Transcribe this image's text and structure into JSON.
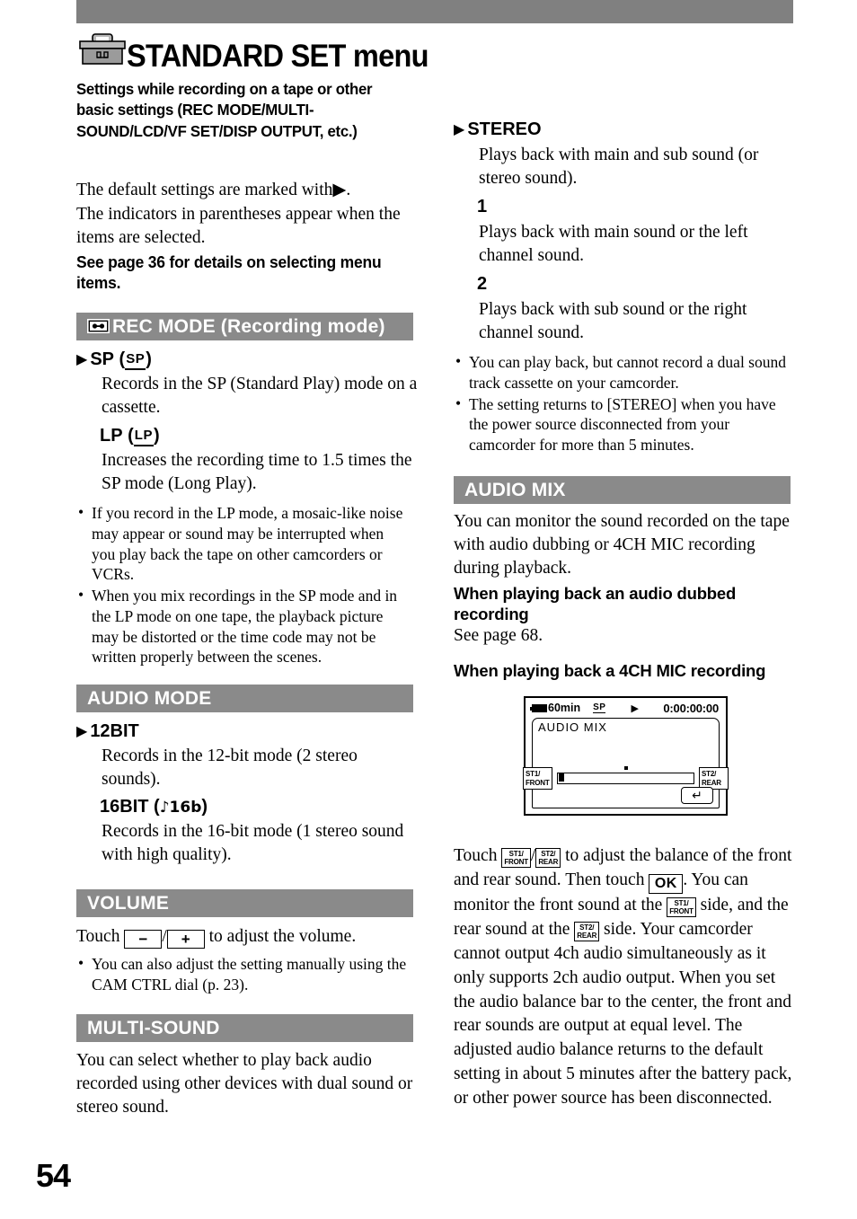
{
  "page": {
    "number": "54",
    "title": "STANDARD SET menu",
    "title_icon": "toolbox-icon",
    "subtitle": "Settings while recording on a tape or other basic settings (REC MODE/MULTI-SOUND/LCD/VF SET/DISP OUTPUT, etc.)"
  },
  "intro": {
    "line1": "The default settings are marked with",
    "line1_glyph": "▶",
    "line1_end": ".",
    "line2": "The indicators in parentheses appear when the items are selected.",
    "bold_note": "See page 36 for details on selecting menu items."
  },
  "sections": {
    "rec_mode": {
      "icon": "cassette-icon",
      "heading": "REC MODE (Recording mode)",
      "options": [
        {
          "default_marker": "▶",
          "label": "SP",
          "indicator": "SP",
          "description": "Records in the SP (Standard Play) mode on a cassette."
        },
        {
          "default_marker": "",
          "label": "LP",
          "indicator": "LP",
          "description": "Increases the recording time to 1.5 times the SP mode (Long Play)."
        }
      ],
      "notes": [
        "If you record in the LP mode, a mosaic-like noise may appear or sound may be interrupted when you play back the tape on other camcorders or VCRs.",
        "When you mix recordings in the SP mode and in the LP mode on one tape, the playback picture may be distorted or the time code may not be written properly between the scenes."
      ]
    },
    "audio_mode": {
      "heading": "AUDIO MODE",
      "options": [
        {
          "default_marker": "▶",
          "label": "12BIT",
          "indicator": "",
          "description": "Records in the 12-bit mode (2 stereo sounds)."
        },
        {
          "default_marker": "",
          "label": "16BIT",
          "indicator": "♪16b",
          "description": "Records in the 16-bit mode (1 stereo sound with high quality)."
        }
      ]
    },
    "volume": {
      "heading": "VOLUME",
      "touch_prefix": "Touch",
      "btn_minus": "−",
      "btn_slash": "/",
      "btn_plus": "+",
      "touch_suffix": "to adjust the volume.",
      "notes": [
        "You can also adjust the setting manually using the CAM CTRL dial (p. 23)."
      ]
    },
    "multi_sound": {
      "heading": "MULTI-SOUND",
      "body": "You can select whether to play back audio recorded using other devices with dual sound or stereo sound.",
      "options": [
        {
          "default_marker": "▶",
          "label": "STEREO",
          "description": "Plays back with main and sub sound (or stereo sound)."
        },
        {
          "default_marker": "",
          "label": "1",
          "description": "Plays back with main sound or the left channel sound."
        },
        {
          "default_marker": "",
          "label": "2",
          "description": "Plays back with sub sound or the right channel sound."
        }
      ],
      "notes": [
        "You can play back, but cannot record a dual sound track cassette on your camcorder.",
        "The setting returns to [STEREO] when you have the power source disconnected from your camcorder for more than 5 minutes."
      ]
    },
    "audio_mix": {
      "heading": "AUDIO MIX",
      "body": "You can monitor the sound recorded on the tape with audio dubbing or 4CH MIC recording during playback.",
      "sub1_heading": "When playing back an audio dubbed recording",
      "sub1_body": "See page 68.",
      "sub2_heading": "When playing back a 4CH MIC recording",
      "instructions": {
        "p1_prefix": "Touch",
        "btn_st1": "ST1/ FRONT",
        "btn_st1_l1": "ST1/",
        "btn_st1_l2": "FRONT",
        "btn_st2_l1": "ST2/",
        "btn_st2_l2": "REAR",
        "slash": "/",
        "p1_mid": "to adjust the balance of the front and rear sound. Then touch",
        "btn_ok": "OK",
        "p1_after_ok": ". You can monitor the front sound at the",
        "p2_mid": "side, and the rear sound at the",
        "p3": "side. Your camcorder cannot output 4ch audio simultaneously as it only supports 2ch audio output. When you set the audio balance bar to the center, the front and rear sounds are output at equal level. The adjusted audio balance returns to the default setting in about 5 minutes after the battery pack, or other power source has been disconnected."
      }
    }
  },
  "lcd_figure": {
    "battery_time": "60min",
    "rec_mode_indicator": "SP",
    "play_glyph": "▶",
    "timecode": "0:00:00:00",
    "menu_label": "AUDIO  MIX",
    "left_button_line1": "ST1/",
    "left_button_line2": "FRONT",
    "right_button_line1": "ST2/",
    "right_button_line2": "REAR",
    "ok_glyph": "↵"
  },
  "colors": {
    "band_gray": "#808080",
    "section_gray": "#8a8a8a",
    "text": "#000000"
  }
}
